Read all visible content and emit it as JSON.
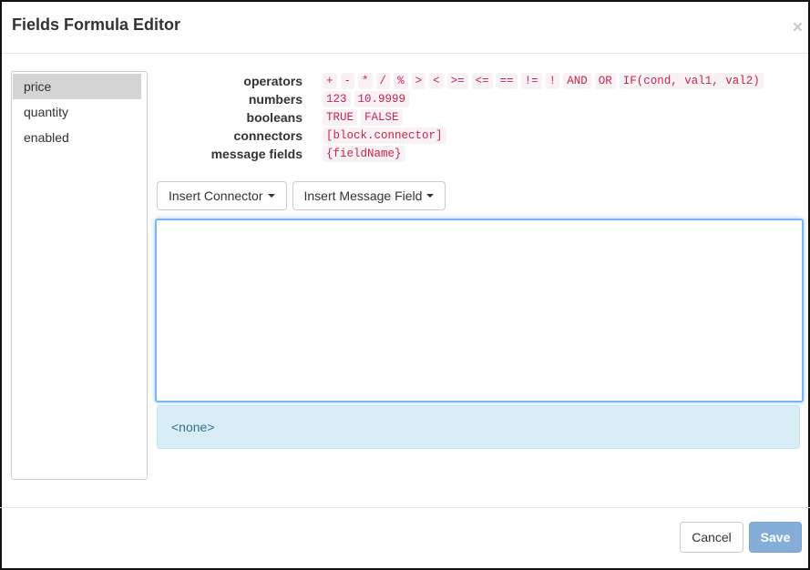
{
  "modal": {
    "title": "Fields Formula Editor",
    "close_glyph": "×"
  },
  "fields": [
    {
      "label": "price",
      "active": true
    },
    {
      "label": "quantity",
      "active": false
    },
    {
      "label": "enabled",
      "active": false
    }
  ],
  "legend": {
    "operators_label": "operators",
    "operators": [
      "+",
      "-",
      "*",
      "/",
      "%",
      ">",
      "<",
      ">=",
      "<=",
      "==",
      "!=",
      "!",
      "AND",
      "OR",
      "IF(cond, val1, val2)"
    ],
    "numbers_label": "numbers",
    "numbers": [
      "123",
      "10.9999"
    ],
    "booleans_label": "booleans",
    "booleans": [
      "TRUE",
      "FALSE"
    ],
    "connectors_label": "connectors",
    "connectors": [
      "[block.connector]"
    ],
    "message_fields_label": "message fields",
    "message_fields": [
      "{fieldName}"
    ]
  },
  "toolbar": {
    "insert_connector_label": "Insert Connector",
    "insert_message_field_label": "Insert Message Field"
  },
  "editor": {
    "value": "",
    "result_text": "<none>"
  },
  "footer": {
    "cancel_label": "Cancel",
    "save_label": "Save"
  },
  "colors": {
    "code_text": "#c7254e",
    "code_bg": "#f9f2f4",
    "focus_border": "#7ab6f2",
    "info_bg": "#d9edf7",
    "info_text": "#31708f",
    "save_disabled_bg": "#84aed8",
    "active_item_bg": "#d4d4d4"
  }
}
